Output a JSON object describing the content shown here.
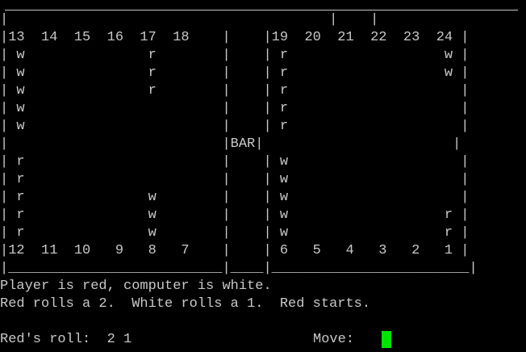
{
  "terminal": {
    "colors": {
      "background": "#000000",
      "text": "#c8c8c8",
      "cursor": "#00e400"
    },
    "board": {
      "lines": [
        "|                                       |    |                                     |",
        "|13  14  15  16  17  18    |    |19  20  21  22  23  24 |",
        "| w               r        |    | r                   w |",
        "| w               r        |    | r                   w |",
        "| w               r        |    | r                     |",
        "| w                        |    | r                     |",
        "| w                        |    | r                     |",
        "|                          |BAR|                       |",
        "| r                        |    | w                     |",
        "| r                        |    | w                     |",
        "| r               w        |    | w                     |",
        "| r               w        |    | w                   r |",
        "| r               w        |    | w                   r |",
        "|12  11  10   9   8   7    |    | 6   5   4   3   2   1 |",
        "|__________________________|____|________________________|"
      ]
    },
    "messages": {
      "line1": "Player is red, computer is white.",
      "line2": "Red rolls a 2.  White rolls a 1.  Red starts."
    },
    "prompt": {
      "roll_label": "Red's roll:  2 1",
      "move_label": "Move:"
    }
  }
}
